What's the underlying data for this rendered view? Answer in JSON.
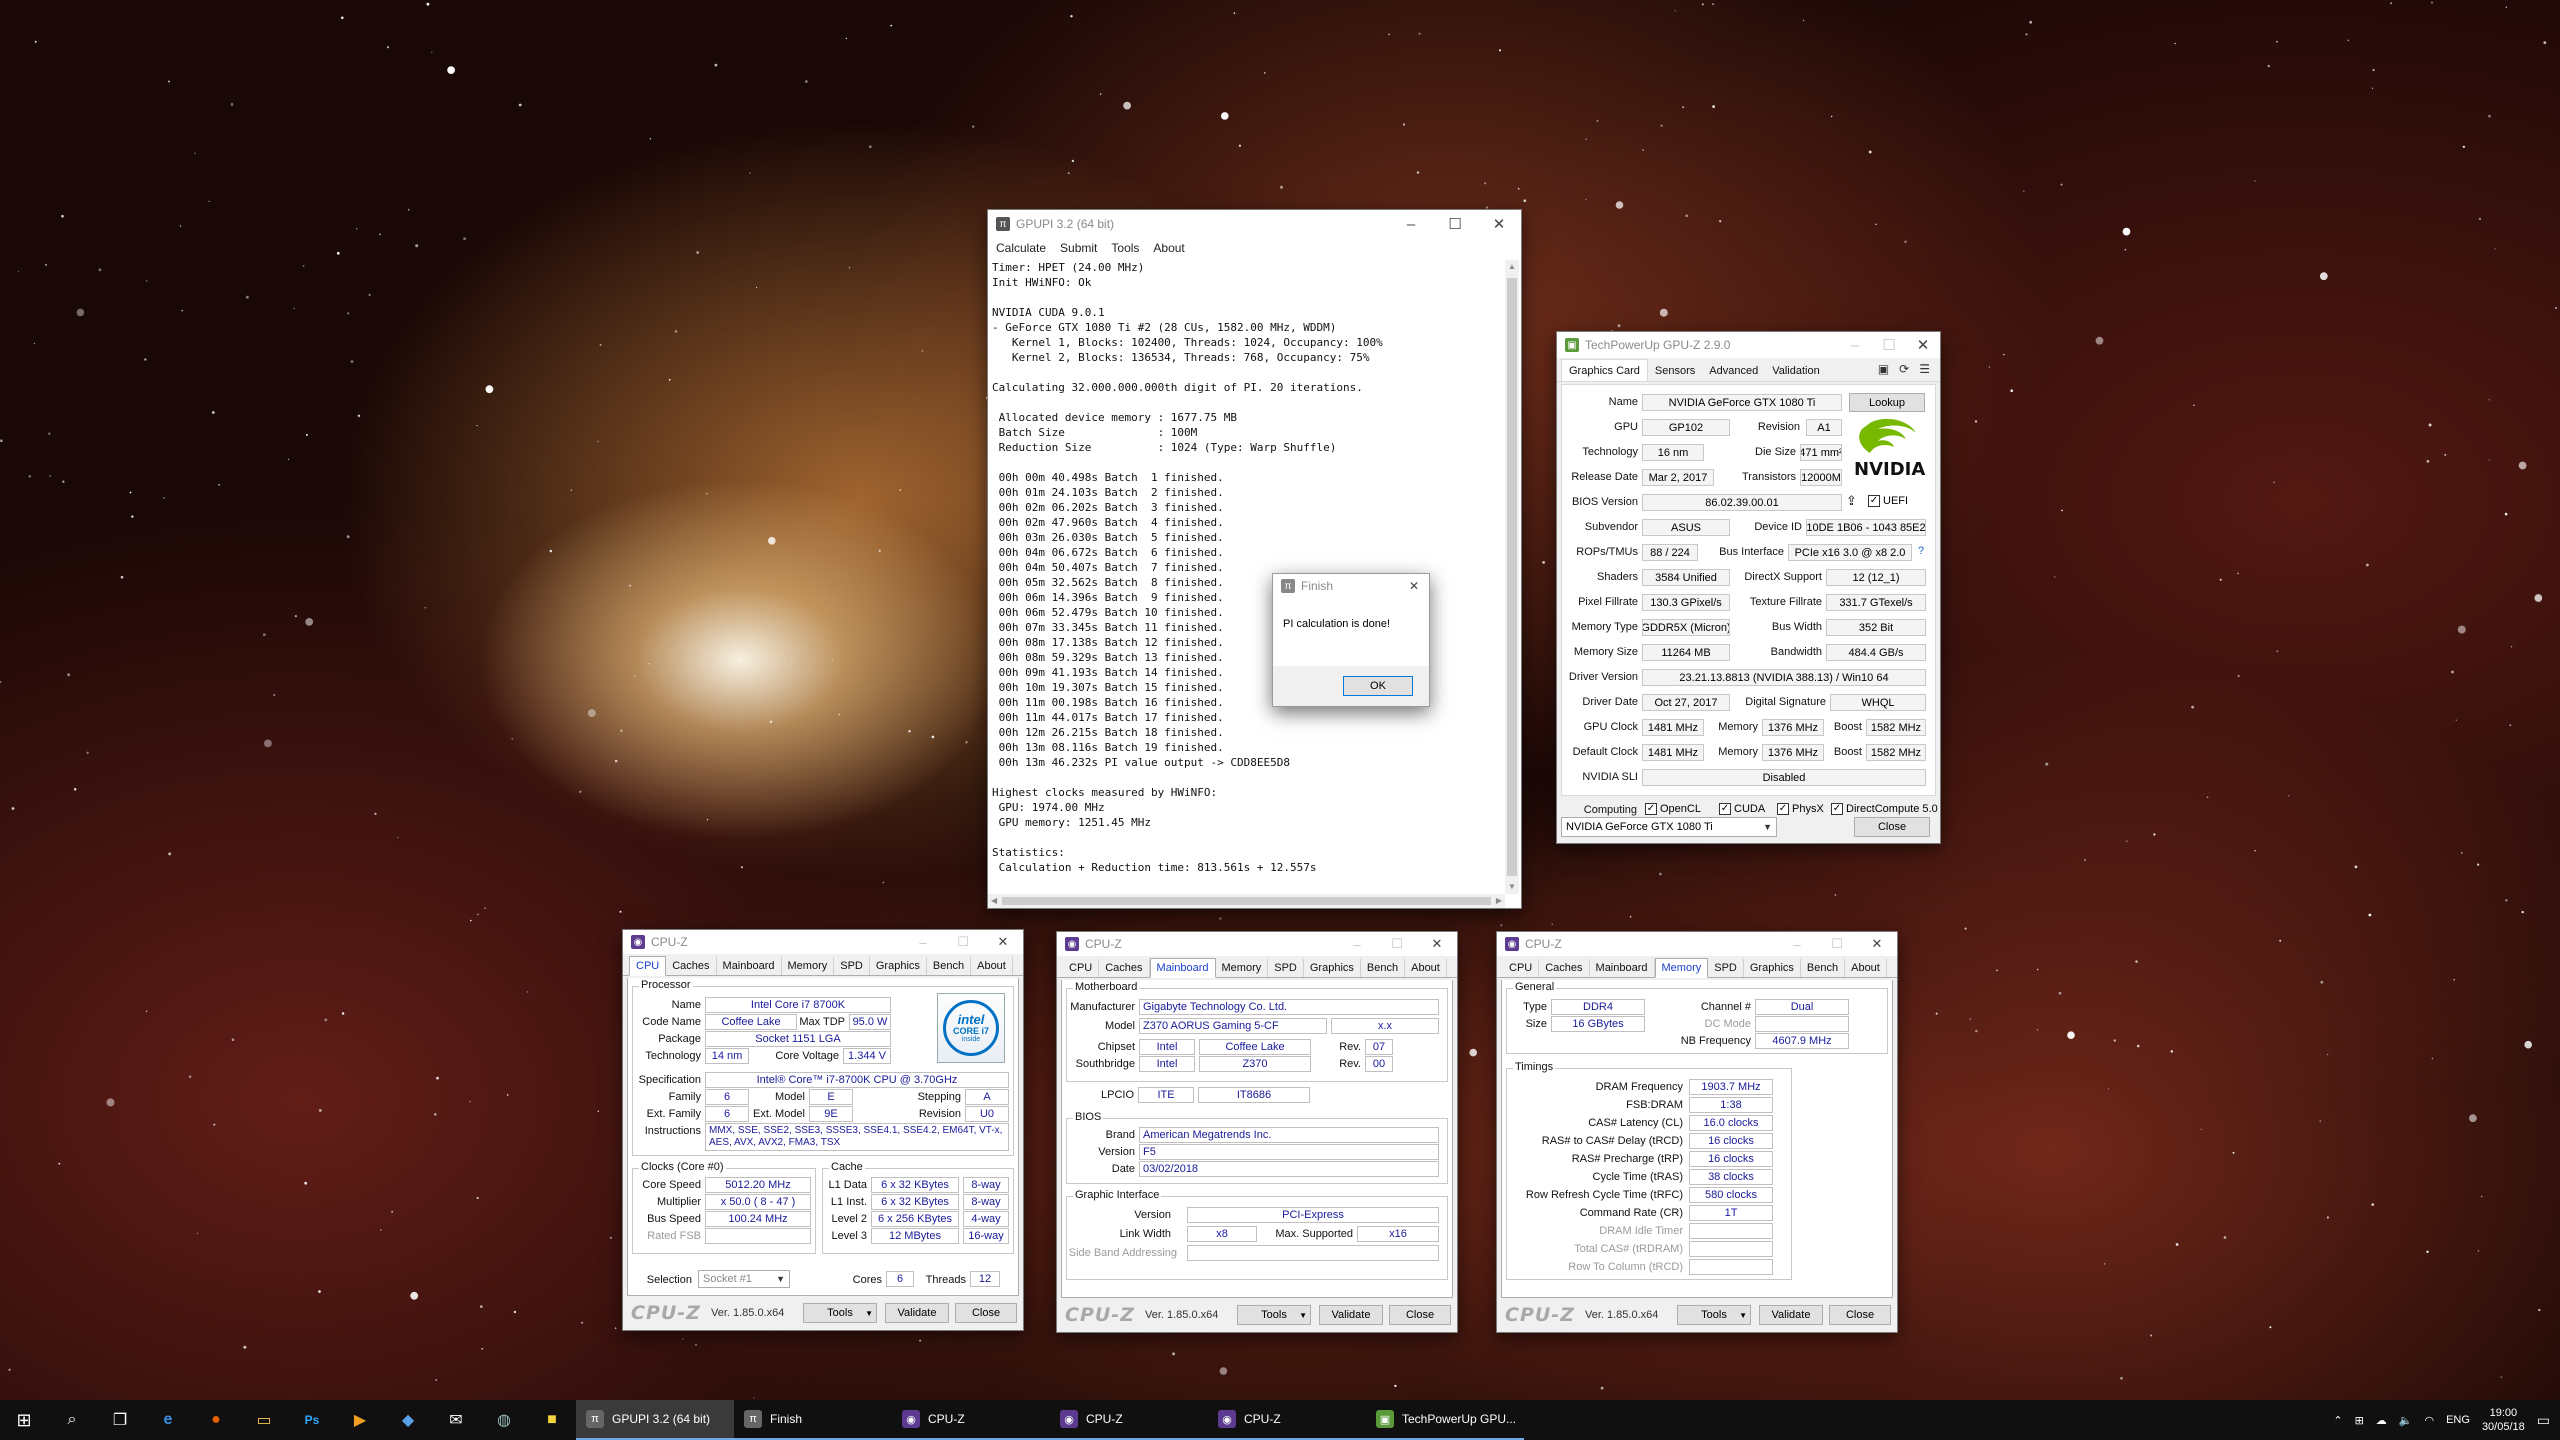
{
  "gpupi": {
    "title": "GPUPI 3.2 (64 bit)",
    "menu": [
      "Calculate",
      "Submit",
      "Tools",
      "About"
    ],
    "lines": [
      "Timer: HPET (24.00 MHz)",
      "Init HWiNFO: Ok",
      "",
      "NVIDIA CUDA 9.0.1",
      "- GeForce GTX 1080 Ti #2 (28 CUs, 1582.00 MHz, WDDM)",
      "   Kernel 1, Blocks: 102400, Threads: 1024, Occupancy: 100%",
      "   Kernel 2, Blocks: 136534, Threads: 768, Occupancy: 75%",
      "",
      "Calculating 32.000.000.000th digit of PI. 20 iterations.",
      "",
      " Allocated device memory : 1677.75 MB",
      " Batch Size              : 100M",
      " Reduction Size          : 1024 (Type: Warp Shuffle)",
      "",
      " 00h 00m 40.498s Batch  1 finished.",
      " 00h 01m 24.103s Batch  2 finished.",
      " 00h 02m 06.202s Batch  3 finished.",
      " 00h 02m 47.960s Batch  4 finished.",
      " 00h 03m 26.030s Batch  5 finished.",
      " 00h 04m 06.672s Batch  6 finished.",
      " 00h 04m 50.407s Batch  7 finished.",
      " 00h 05m 32.562s Batch  8 finished.",
      " 00h 06m 14.396s Batch  9 finished.",
      " 00h 06m 52.479s Batch 10 finished.",
      " 00h 07m 33.345s Batch 11 finished.",
      " 00h 08m 17.138s Batch 12 finished.",
      " 00h 08m 59.329s Batch 13 finished.",
      " 00h 09m 41.193s Batch 14 finished.",
      " 00h 10m 19.307s Batch 15 finished.",
      " 00h 11m 00.198s Batch 16 finished.",
      " 00h 11m 44.017s Batch 17 finished.",
      " 00h 12m 26.215s Batch 18 finished.",
      " 00h 13m 08.116s Batch 19 finished.",
      " 00h 13m 46.232s PI value output -> CDD8EE5D8",
      "",
      "Highest clocks measured by HWiNFO:",
      " GPU: 1974.00 MHz",
      " GPU memory: 1251.45 MHz",
      "",
      "Statistics:",
      " Calculation + Reduction time: 813.561s + 12.557s"
    ]
  },
  "finish": {
    "title": "Finish",
    "message": "PI calculation is done!",
    "ok": "OK"
  },
  "gpuz": {
    "title": "TechPowerUp GPU-Z 2.9.0",
    "tabs": [
      "Graphics Card",
      "Sensors",
      "Advanced",
      "Validation"
    ],
    "labels": {
      "name": "Name",
      "gpu": "GPU",
      "revision": "Revision",
      "technology": "Technology",
      "die_size": "Die Size",
      "release_date": "Release Date",
      "transistors": "Transistors",
      "bios": "BIOS Version",
      "subvendor": "Subvendor",
      "device_id": "Device ID",
      "rops": "ROPs/TMUs",
      "bus_interface": "Bus Interface",
      "shaders": "Shaders",
      "directx": "DirectX Support",
      "pixel": "Pixel Fillrate",
      "texture": "Texture Fillrate",
      "mem_type": "Memory Type",
      "bus_width": "Bus Width",
      "mem_size": "Memory Size",
      "bandwidth": "Bandwidth",
      "driver_ver": "Driver Version",
      "driver_date": "Driver Date",
      "dig_sig": "Digital Signature",
      "gpu_clock": "GPU Clock",
      "memory": "Memory",
      "boost": "Boost",
      "default_clock": "Default Clock",
      "sli": "NVIDIA SLI",
      "computing": "Computing"
    },
    "values": {
      "name": "NVIDIA GeForce GTX 1080 Ti",
      "lookup": "Lookup",
      "gpu": "GP102",
      "revision": "A1",
      "technology": "16 nm",
      "die_size": "471 mm²",
      "release_date": "Mar 2, 2017",
      "transistors": "12000M",
      "bios": "86.02.39.00.01",
      "uefi": "UEFI",
      "subvendor": "ASUS",
      "device_id": "10DE 1B06 - 1043 85E2",
      "rops": "88 / 224",
      "bus_interface": "PCIe x16 3.0 @ x8 2.0",
      "help": "?",
      "shaders": "3584 Unified",
      "directx": "12 (12_1)",
      "pixel": "130.3 GPixel/s",
      "texture": "331.7 GTexel/s",
      "mem_type": "GDDR5X (Micron)",
      "bus_width": "352 Bit",
      "mem_size": "11264 MB",
      "bandwidth": "484.4 GB/s",
      "driver_ver": "23.21.13.8813 (NVIDIA 388.13) / Win10 64",
      "driver_date": "Oct 27, 2017",
      "dig_sig": "WHQL",
      "gpu_clock": "1481 MHz",
      "gpu_mem": "1376 MHz",
      "gpu_boost": "1582 MHz",
      "def_clock": "1481 MHz",
      "def_mem": "1376 MHz",
      "def_boost": "1582 MHz",
      "sli": "Disabled"
    },
    "computing": [
      "OpenCL",
      "CUDA",
      "PhysX",
      "DirectCompute 5.0"
    ],
    "logo_text": "NVIDIA",
    "selected_card": "NVIDIA GeForce GTX 1080 Ti",
    "close": "Close"
  },
  "cpuz_common": {
    "title": "CPU-Z",
    "tabs": [
      "CPU",
      "Caches",
      "Mainboard",
      "Memory",
      "SPD",
      "Graphics",
      "Bench",
      "About"
    ],
    "logo": "CPU-Z",
    "version": "Ver. 1.85.0.x64",
    "tools": "Tools",
    "validate": "Validate",
    "close": "Close"
  },
  "cpuz_cpu": {
    "processor_group": "Processor",
    "name_l": "Name",
    "name": "Intel Core i7 8700K",
    "codename_l": "Code Name",
    "codename": "Coffee Lake",
    "tdp_l": "Max TDP",
    "tdp": "95.0 W",
    "package_l": "Package",
    "package": "Socket 1151 LGA",
    "tech_l": "Technology",
    "tech": "14 nm",
    "voltage_l": "Core Voltage",
    "voltage": "1.344 V",
    "spec_l": "Specification",
    "spec": "Intel® Core™ i7-8700K CPU @ 3.70GHz",
    "family_l": "Family",
    "family": "6",
    "model_l": "Model",
    "model": "E",
    "stepping_l": "Stepping",
    "stepping": "A",
    "extfam_l": "Ext. Family",
    "extfam": "6",
    "extmodel_l": "Ext. Model",
    "extmodel": "9E",
    "revision_l": "Revision",
    "revision": "U0",
    "instr_l": "Instructions",
    "instr": "MMX, SSE, SSE2, SSE3, SSSE3, SSE4.1, SSE4.2, EM64T, VT-x, AES, AVX, AVX2, FMA3, TSX",
    "clocks_group": "Clocks (Core #0)",
    "corespeed_l": "Core Speed",
    "corespeed": "5012.20 MHz",
    "mult_l": "Multiplier",
    "mult": "x 50.0 ( 8 - 47 )",
    "bus_l": "Bus Speed",
    "bus": "100.24 MHz",
    "fsb_l": "Rated FSB",
    "cache_group": "Cache",
    "l1d_l": "L1 Data",
    "l1d": "6 x 32 KBytes",
    "l1d_w": "8-way",
    "l1i_l": "L1 Inst.",
    "l1i": "6 x 32 KBytes",
    "l1i_w": "8-way",
    "l2_l": "Level 2",
    "l2": "6 x 256 KBytes",
    "l2_w": "4-way",
    "l3_l": "Level 3",
    "l3": "12 MBytes",
    "l3_w": "16-way",
    "selection_l": "Selection",
    "selection": "Socket #1",
    "cores_l": "Cores",
    "cores": "6",
    "threads_l": "Threads",
    "threads": "12",
    "intel_1": "intel",
    "intel_2": "CORE i7",
    "intel_3": "inside"
  },
  "cpuz_mb": {
    "mb_group": "Motherboard",
    "manu_l": "Manufacturer",
    "manu": "Gigabyte Technology Co. Ltd.",
    "model_l": "Model",
    "model": "Z370 AORUS Gaming 5-CF",
    "model_rev": "x.x",
    "chipset_l": "Chipset",
    "chipset_v": "Intel",
    "chipset_n": "Coffee Lake",
    "rev_l": "Rev.",
    "chipset_rev": "07",
    "south_l": "Southbridge",
    "south_v": "Intel",
    "south_n": "Z370",
    "south_rev": "00",
    "lpcio_l": "LPCIO",
    "lpcio_v": "ITE",
    "lpcio_n": "IT8686",
    "bios_group": "BIOS",
    "brand_l": "Brand",
    "brand": "American Megatrends Inc.",
    "version_l": "Version",
    "version": "F5",
    "date_l": "Date",
    "date": "03/02/2018",
    "gi_group": "Graphic Interface",
    "gi_ver_l": "Version",
    "gi_ver": "PCI-Express",
    "lw_l": "Link Width",
    "lw": "x8",
    "ms_l": "Max. Supported",
    "ms": "x16",
    "sba_l": "Side Band Addressing"
  },
  "cpuz_mem": {
    "general_group": "General",
    "type_l": "Type",
    "type": "DDR4",
    "channel_l": "Channel #",
    "channel": "Dual",
    "size_l": "Size",
    "size": "16 GBytes",
    "dc_l": "DC Mode",
    "nb_l": "NB Frequency",
    "nb": "4607.9 MHz",
    "timings_group": "Timings",
    "dram_l": "DRAM Frequency",
    "dram": "1903.7 MHz",
    "fsb_l": "FSB:DRAM",
    "fsb": "1:38",
    "cl_l": "CAS# Latency (CL)",
    "cl": "16.0 clocks",
    "trcd_l": "RAS# to CAS# Delay (tRCD)",
    "trcd": "16 clocks",
    "trp_l": "RAS# Precharge (tRP)",
    "trp": "16 clocks",
    "tras_l": "Cycle Time (tRAS)",
    "tras": "38 clocks",
    "trfc_l": "Row Refresh Cycle Time (tRFC)",
    "trfc": "580 clocks",
    "cr_l": "Command Rate (CR)",
    "cr": "1T",
    "idle_l": "DRAM Idle Timer",
    "tcas_l": "Total CAS# (tRDRAM)",
    "trcd2_l": "Row To Column (tRCD)"
  },
  "taskbar": {
    "apps": [
      {
        "label": "GPUPI 3.2 (64 bit)",
        "icon": "pi-icon"
      },
      {
        "label": "Finish",
        "icon": "pi-icon"
      },
      {
        "label": "CPU-Z",
        "icon": "cpuz-icon"
      },
      {
        "label": "CPU-Z",
        "icon": "cpuz-icon"
      },
      {
        "label": "CPU-Z",
        "icon": "cpuz-icon"
      },
      {
        "label": "TechPowerUp GPU...",
        "icon": "gpuz-icon"
      }
    ],
    "lang": "ENG",
    "time": "19:00",
    "date": "30/05/18"
  },
  "colors": {
    "accent": "#0071c5",
    "nvidia_green": "#76b900",
    "cpuz_tab_blue": "#1a3fd0",
    "taskbar_underline": "#6ea8e8"
  }
}
